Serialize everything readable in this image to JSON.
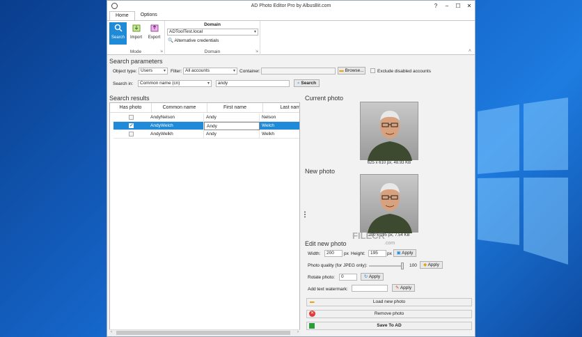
{
  "window": {
    "title": "AD Photo Editor Pro by AlbusBit.com",
    "controls": [
      "?",
      "–",
      "☐",
      "✕"
    ]
  },
  "tabs": [
    {
      "label": "Home",
      "active": true
    },
    {
      "label": "Options",
      "active": false
    }
  ],
  "ribbon": {
    "mode": {
      "label": "Mode",
      "buttons": [
        "Search",
        "Import",
        "Export"
      ]
    },
    "domain": {
      "title": "Domain",
      "label": "Domain",
      "value": "ADToolTest.local",
      "alt_credentials": "Alternative credentials"
    }
  },
  "search_params": {
    "header": "Search parameters",
    "object_type_label": "Object type:",
    "object_type": "Users",
    "filter_label": "Filter:",
    "filter": "All accounts",
    "container_label": "Container:",
    "container": "",
    "browse": "Browse...",
    "exclude_disabled": "Exclude disabled accounts",
    "search_in_label": "Search in:",
    "search_in": "Common name (cn)",
    "query": "andy",
    "search_button": "Search"
  },
  "results": {
    "header": "Search results",
    "columns": [
      "Has photo",
      "Common name",
      "First name",
      "Last name"
    ],
    "rows": [
      {
        "has_photo": false,
        "cn": "AndyNelson",
        "first": "Andy",
        "last": "Nelson",
        "selected": false
      },
      {
        "has_photo": true,
        "cn": "AndyWelch",
        "first": "Andy",
        "last": "Welch",
        "selected": true
      },
      {
        "has_photo": false,
        "cn": "AndyWelkh",
        "first": "Andy",
        "last": "Welkh",
        "selected": false
      }
    ]
  },
  "current_photo": {
    "header": "Current photo",
    "caption": "625 x 610 px, 48.93 KB"
  },
  "new_photo": {
    "header": "New photo",
    "caption": "200 x 195 px, 7.54 KB"
  },
  "watermark": {
    "text": "FILECR",
    "sub": ".com"
  },
  "edit": {
    "header": "Edit new photo",
    "width_label": "Width:",
    "width": "200",
    "px1": "px",
    "height_label": "Height:",
    "height": "195",
    "px2": "px",
    "apply": "Apply",
    "quality_label": "Photo quality (for JPEG only):",
    "quality": "100",
    "quality_fraction": 1.0,
    "rotate_label": "Rotate photo:",
    "rotate": "0",
    "text_watermark_label": "Add text watermark:",
    "text_watermark": "",
    "load": "Load new photo",
    "remove": "Remove photo",
    "save": "Save To AD"
  },
  "colors": {
    "accent": "#1f8ad8"
  }
}
